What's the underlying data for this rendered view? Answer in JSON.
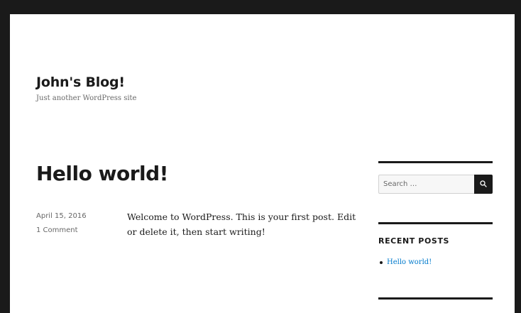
{
  "site": {
    "title": "John's Blog!",
    "description": "Just another WordPress site"
  },
  "post": {
    "title": "Hello world!",
    "date": "April 15, 2016",
    "comments": "1 Comment",
    "content": "Welcome to WordPress. This is your first post. Edit or delete it, then start writing!"
  },
  "sidebar": {
    "search": {
      "placeholder": "Search …",
      "button_icon": "search-icon"
    },
    "recent_posts": {
      "title": "RECENT POSTS",
      "items": [
        {
          "label": "Hello world!"
        }
      ]
    }
  },
  "colors": {
    "text": "#1a1a1a",
    "muted": "#686868",
    "link": "#007acc",
    "frame": "#1a1a1a"
  }
}
